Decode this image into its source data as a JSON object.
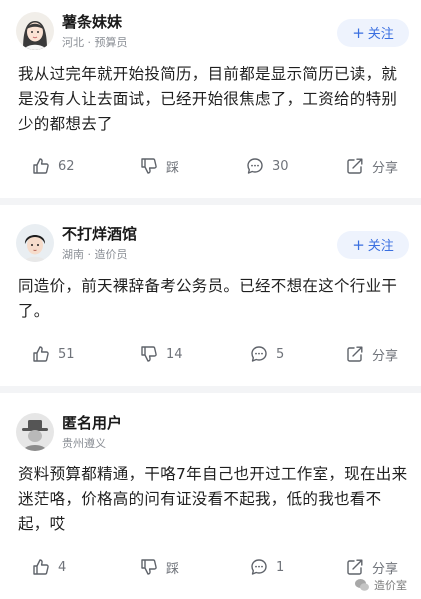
{
  "posts": [
    {
      "author": "薯条妹妹",
      "meta": "河北 · 预算员",
      "follow_label": "关注",
      "content": "我从过完年就开始投简历，目前都是显示简历已读，就是没有人让去面试，已经开始很焦虑了，工资给的特别少的都想去了",
      "likes": "62",
      "dislike_label": "踩",
      "comments": "30",
      "share_label": "分享"
    },
    {
      "author": "不打烊酒馆",
      "meta": "湖南 · 造价员",
      "follow_label": "关注",
      "content": "同造价，前天裸辞备考公务员。已经不想在这个行业干了。",
      "likes": "51",
      "dislike_count": "14",
      "comments": "5",
      "share_label": "分享"
    },
    {
      "author": "匿名用户",
      "meta": "贵州遵义",
      "content": "资料预算都精通，干咯7年自己也开过工作室，现在出来迷茫咯，价格高的问有证没看不起我，低的我也看不起，哎",
      "likes": "4",
      "dislike_label": "踩",
      "comments": "1",
      "share_label": "分享"
    }
  ],
  "watermark": "造价室",
  "colors": {
    "accent": "#3a6fe0",
    "follow_bg": "#eef3fd",
    "separator": "#f3f4f6",
    "muted": "#8b8f96"
  }
}
